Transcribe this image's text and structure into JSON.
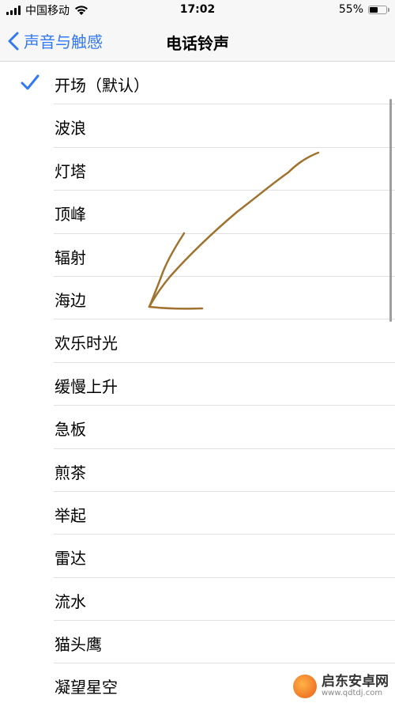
{
  "status_bar": {
    "carrier": "中国移动",
    "time": "17:02",
    "battery_percent_label": "55%",
    "battery_level": 0.55
  },
  "nav": {
    "back_label": "声音与触感",
    "title": "电话铃声"
  },
  "ringtones": [
    {
      "label": "开场（默认）",
      "selected": true
    },
    {
      "label": "波浪",
      "selected": false
    },
    {
      "label": "灯塔",
      "selected": false
    },
    {
      "label": "顶峰",
      "selected": false
    },
    {
      "label": "辐射",
      "selected": false
    },
    {
      "label": "海边",
      "selected": false
    },
    {
      "label": "欢乐时光",
      "selected": false
    },
    {
      "label": "缓慢上升",
      "selected": false
    },
    {
      "label": "急板",
      "selected": false
    },
    {
      "label": "煎茶",
      "selected": false
    },
    {
      "label": "举起",
      "selected": false
    },
    {
      "label": "雷达",
      "selected": false
    },
    {
      "label": "流水",
      "selected": false
    },
    {
      "label": "猫头鹰",
      "selected": false
    },
    {
      "label": "凝望星空",
      "selected": false
    }
  ],
  "watermark": {
    "name": "启东安卓网",
    "url": "www.qdtdj.com"
  },
  "colors": {
    "accent": "#3478f6",
    "annotation": "#a0722e"
  },
  "icons": {
    "check": "checkmark-icon",
    "back": "chevron-left-icon"
  }
}
